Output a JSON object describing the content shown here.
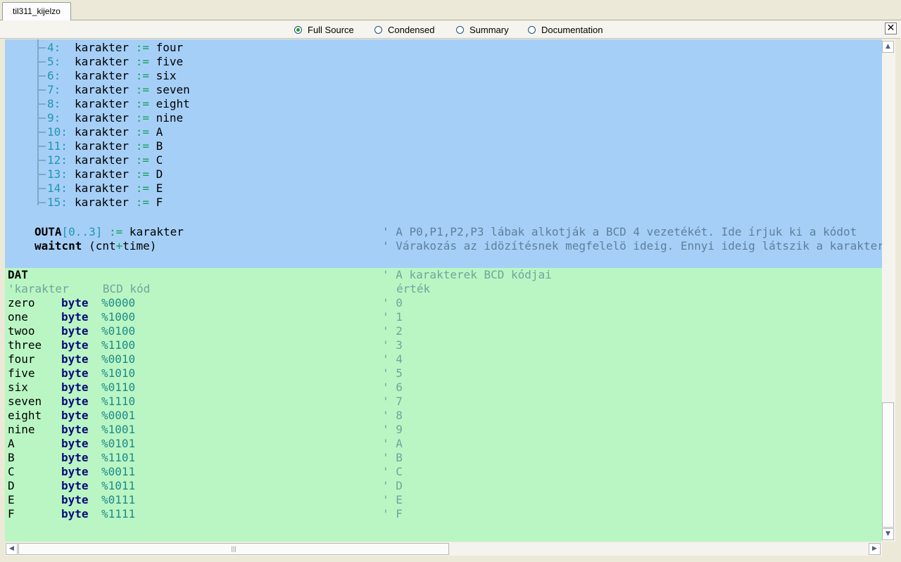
{
  "tab": {
    "label": "til311_kijelzo"
  },
  "view_modes": [
    {
      "label": "Full Source",
      "selected": true
    },
    {
      "label": "Condensed",
      "selected": false
    },
    {
      "label": "Summary",
      "selected": false
    },
    {
      "label": "Documentation",
      "selected": false
    }
  ],
  "close_label": "✕",
  "pub_region": {
    "case_lines": [
      {
        "num": "4:",
        "var": "karakter",
        "op": ":=",
        "val": "four"
      },
      {
        "num": "5:",
        "var": "karakter",
        "op": ":=",
        "val": "five"
      },
      {
        "num": "6:",
        "var": "karakter",
        "op": ":=",
        "val": "six"
      },
      {
        "num": "7:",
        "var": "karakter",
        "op": ":=",
        "val": "seven"
      },
      {
        "num": "8:",
        "var": "karakter",
        "op": ":=",
        "val": "eight"
      },
      {
        "num": "9:",
        "var": "karakter",
        "op": ":=",
        "val": "nine"
      },
      {
        "num": "10:",
        "var": "karakter",
        "op": ":=",
        "val": "A"
      },
      {
        "num": "11:",
        "var": "karakter",
        "op": ":=",
        "val": "B"
      },
      {
        "num": "12:",
        "var": "karakter",
        "op": ":=",
        "val": "C"
      },
      {
        "num": "13:",
        "var": "karakter",
        "op": ":=",
        "val": "D"
      },
      {
        "num": "14:",
        "var": "karakter",
        "op": ":=",
        "val": "E"
      },
      {
        "num": "15:",
        "var": "karakter",
        "op": ":=",
        "val": "F"
      }
    ],
    "outa_line": {
      "keyword": "OUTA",
      "range": "[0..3]",
      "op": ":=",
      "value": "karakter",
      "comment": "' A P0,P1,P2,P3 lábak alkotják a BCD 4 vezetékét. Ide írjuk ki a kódot"
    },
    "waitcnt_line": {
      "keyword": "waitcnt",
      "args_open": "(cnt",
      "plus": "+",
      "args_close": "time)",
      "comment": "' Várakozás az idözítésnek megfelelö ideig. Ennyi ideig látszik a karakter"
    }
  },
  "dat_region": {
    "header": {
      "keyword": "DAT",
      "comment": "' A karakterek BCD kódjai"
    },
    "column_header": {
      "label": "'karakter     BCD kód",
      "comment": "érték"
    },
    "rows": [
      {
        "name": "zero",
        "type": "byte",
        "code": "%0000",
        "comment": "' 0"
      },
      {
        "name": "one",
        "type": "byte",
        "code": "%1000",
        "comment": "' 1"
      },
      {
        "name": "twoo",
        "type": "byte",
        "code": "%0100",
        "comment": "' 2"
      },
      {
        "name": "three",
        "type": "byte",
        "code": "%1100",
        "comment": "' 3"
      },
      {
        "name": "four",
        "type": "byte",
        "code": "%0010",
        "comment": "' 4"
      },
      {
        "name": "five",
        "type": "byte",
        "code": "%1010",
        "comment": "' 5"
      },
      {
        "name": "six",
        "type": "byte",
        "code": "%0110",
        "comment": "' 6"
      },
      {
        "name": "seven",
        "type": "byte",
        "code": "%1110",
        "comment": "' 7"
      },
      {
        "name": "eight",
        "type": "byte",
        "code": "%0001",
        "comment": "' 8"
      },
      {
        "name": "nine",
        "type": "byte",
        "code": "%1001",
        "comment": "' 9"
      },
      {
        "name": "A",
        "type": "byte",
        "code": "%0101",
        "comment": "' A"
      },
      {
        "name": "B",
        "type": "byte",
        "code": "%1101",
        "comment": "' B"
      },
      {
        "name": "C",
        "type": "byte",
        "code": "%0011",
        "comment": "' C"
      },
      {
        "name": "D",
        "type": "byte",
        "code": "%1011",
        "comment": "' D"
      },
      {
        "name": "E",
        "type": "byte",
        "code": "%0111",
        "comment": "' E"
      },
      {
        "name": "F",
        "type": "byte",
        "code": "%1111",
        "comment": "' F"
      }
    ]
  },
  "scrollbars": {
    "up_arrow": "▲",
    "down_arrow": "▼",
    "left_arrow": "◀",
    "right_arrow": "▶",
    "grip": "|||"
  },
  "colors": {
    "pub_background": "#a6cff7",
    "dat_background": "#baf6c3",
    "number": "#2196b0",
    "operator": "#15a05c",
    "comment": "#6ea59c"
  }
}
